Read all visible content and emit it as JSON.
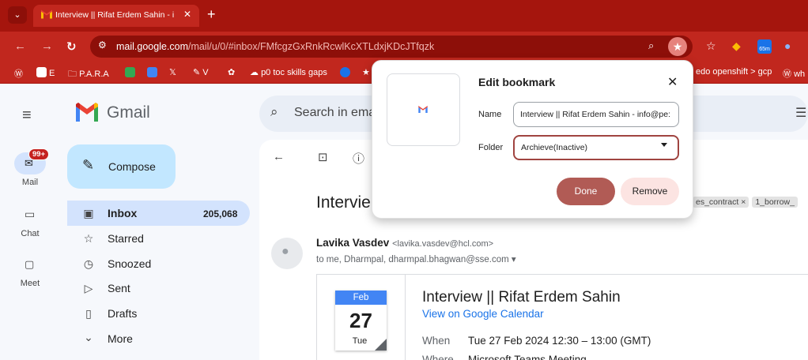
{
  "browser": {
    "tab": {
      "title": "Interview || Rifat Erdem Sahin - i",
      "close": "✕",
      "new_tab": "+"
    },
    "tab_menu": "⌄",
    "url_host": "mail.google.com",
    "url_path": "/mail/u/0/#inbox/FMfcgzGxRnkRcwlKcXTLdxjKDcJTfqzk",
    "bookmarks": [
      {
        "label": "E",
        "icon": "wix-icon",
        "color": "#1a1a1a"
      },
      {
        "label": "P.A.R.A",
        "icon": "folder-icon",
        "color": ""
      },
      {
        "label": "V",
        "icon": "pen-icon",
        "color": "#1a1a1a"
      },
      {
        "label": "p0 toc skills gaps",
        "icon": "cloud-icon",
        "color": ""
      },
      {
        "label": "edo openshift > gcp",
        "icon": "",
        "color": ""
      },
      {
        "label": "wh",
        "icon": "wordpress-icon",
        "color": ""
      }
    ],
    "ext_badge": "65m"
  },
  "gmail": {
    "brand": "Gmail",
    "rail": {
      "mail": "Mail",
      "chat": "Chat",
      "meet": "Meet",
      "badge": "99+"
    },
    "compose": "Compose",
    "nav": [
      {
        "label": "Inbox",
        "count": "205,068",
        "icon": "inbox-icon",
        "glyph": "▣"
      },
      {
        "label": "Starred",
        "count": "",
        "icon": "star-icon",
        "glyph": "☆"
      },
      {
        "label": "Snoozed",
        "count": "",
        "icon": "clock-icon",
        "glyph": "◷"
      },
      {
        "label": "Sent",
        "count": "",
        "icon": "send-icon",
        "glyph": "▷"
      },
      {
        "label": "Drafts",
        "count": "",
        "icon": "draft-icon",
        "glyph": "▯"
      },
      {
        "label": "More",
        "count": "",
        "icon": "chevron-down-icon",
        "glyph": "⌄"
      }
    ],
    "search_placeholder": "Search in ema",
    "subject": "Intervie",
    "labels": [
      "es_contract ×",
      "1_borrow_"
    ],
    "sender_name": "Lavika Vasdev",
    "sender_email": "<lavika.vasdev@hcl.com>",
    "recipients": "to me, Dharmpal, dharmpal.bhagwan@sse.com ▾",
    "event": {
      "month": "Feb",
      "day": "27",
      "weekday": "Tue",
      "title": "Interview || Rifat Erdem Sahin",
      "link": "View on Google Calendar",
      "when_label": "When",
      "when_value": "Tue 27 Feb 2024 12:30 – 13:00 (GMT)",
      "where_label": "Where",
      "where_value": "Microsoft Teams Meeting"
    }
  },
  "dialog": {
    "title": "Edit bookmark",
    "name_label": "Name",
    "name_value": "Interview || Rifat Erdem Sahin - info@pe:",
    "folder_label": "Folder",
    "folder_value": "Archieve(Inactive)",
    "done": "Done",
    "remove": "Remove"
  }
}
